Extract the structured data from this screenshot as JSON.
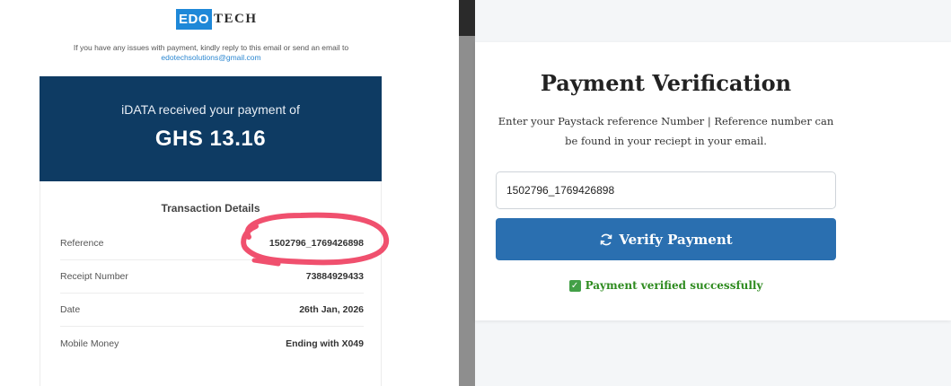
{
  "email": {
    "logo": {
      "part1": "EDO",
      "part2": "TECH"
    },
    "support_text": "If you have any issues with payment, kindly reply to this email or send an email to",
    "support_email": "edotechsolutions@gmail.com",
    "banner_line": "iDATA received your payment of",
    "amount": "GHS 13.16",
    "details_title": "Transaction Details",
    "details": [
      {
        "label": "Reference",
        "value": "1502796_1769426898"
      },
      {
        "label": "Receipt Number",
        "value": "73884929433"
      },
      {
        "label": "Date",
        "value": "26th Jan, 2026"
      },
      {
        "label": "Mobile Money",
        "value": "Ending with X049"
      }
    ],
    "annotation_color": "#f0506e"
  },
  "verify": {
    "title": "Payment Verification",
    "description": "Enter your Paystack reference Number | Reference number can be found in your reciept in your email.",
    "reference_value": "1502796_1769426898",
    "button_label": "Verify Payment",
    "button_icon": "refresh-icon",
    "status_icon": "check-icon",
    "status_text": "Payment verified successfully",
    "colors": {
      "button": "#2a6fb0",
      "success": "#2e8b1f",
      "banner": "#0e3b63"
    }
  }
}
